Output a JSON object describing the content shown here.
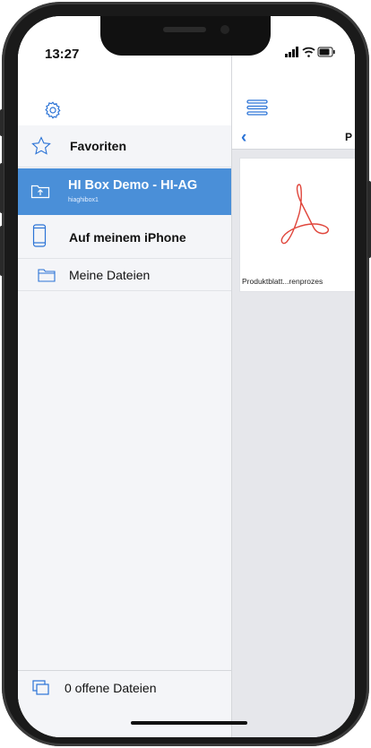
{
  "status_bar": {
    "time": "13:27",
    "signal_icon": "signal-icon",
    "wifi_icon": "wifi-icon",
    "battery_icon": "battery-icon"
  },
  "sidebar": {
    "settings_icon": "gear-icon",
    "items": [
      {
        "label": "Favoriten",
        "icon": "star-icon"
      },
      {
        "label": "HI Box Demo - HI-AG",
        "sublabel": "hiaghibox1",
        "icon": "cloud-folder-icon",
        "selected": true
      },
      {
        "label": "Auf meinem iPhone",
        "icon": "phone-icon"
      },
      {
        "label": "Meine Dateien",
        "icon": "folder-icon"
      }
    ],
    "footer": {
      "label": "0 offene Dateien",
      "icon": "stacked-windows-icon"
    }
  },
  "content": {
    "menu_icon": "hamburger-icon",
    "back_icon": "chevron-left-icon",
    "title": "P",
    "files": [
      {
        "name": "Produktblatt...renprozes",
        "icon": "pdf-icon"
      }
    ]
  },
  "colors": {
    "accent": "#4a8fd8",
    "link": "#2b73d6",
    "pdf": "#e0463c",
    "sidebar_bg": "#f4f5f8",
    "content_bg": "#e6e7eb"
  }
}
